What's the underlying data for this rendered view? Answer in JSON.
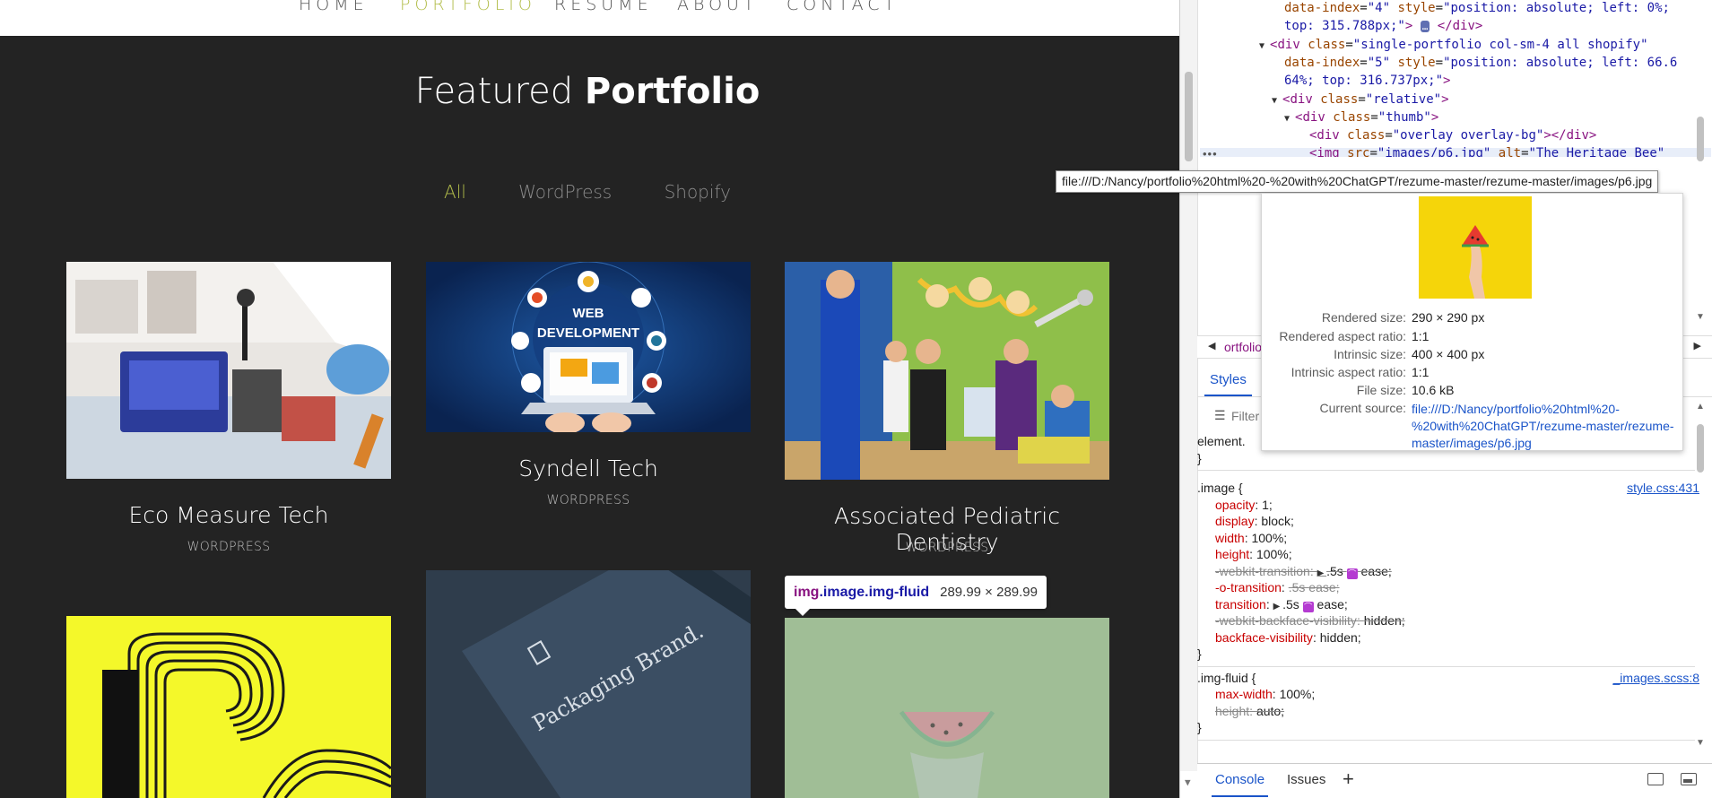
{
  "nav": {
    "items": [
      "HOME",
      "PORTFOLIO",
      "RESUME",
      "ABOUT",
      "CONTACT"
    ],
    "active": "PORTFOLIO"
  },
  "section": {
    "title_light": "Featured",
    "title_bold": "Portfolio"
  },
  "filters": [
    "All",
    "WordPress",
    "Shopify"
  ],
  "projects": [
    {
      "title": "Eco Measure Tech",
      "category": "WORDPRESS"
    },
    {
      "title": "Syndell Tech",
      "category": "WORDPRESS",
      "image_text": [
        "WEB",
        "DEVELOPMENT"
      ]
    },
    {
      "title": "Associated Pediatric Dentistry",
      "category": "WORDPRESS"
    },
    {
      "title": "",
      "category": ""
    },
    {
      "title": "",
      "category": "",
      "image_text": [
        "Packaging Brand."
      ]
    },
    {
      "title": "",
      "category": ""
    }
  ],
  "element_tooltip": {
    "selector_tag": "img",
    "selector_classes": ".image.img-fluid",
    "size": "289.99 × 289.99"
  },
  "devtools": {
    "dom_lines": [
      {
        "indent": 3,
        "parts": [
          [
            "attr",
            "data-index"
          ],
          [
            "txt",
            "="
          ],
          [
            "val",
            "\"4\""
          ],
          [
            "txt",
            " "
          ],
          [
            "attr",
            "style"
          ],
          [
            "txt",
            "="
          ],
          [
            "val",
            "\"position: absolute; left: 0%;"
          ]
        ]
      },
      {
        "indent": 3,
        "parts": [
          [
            "val",
            "top: 315.788px;\""
          ],
          [
            "tag",
            "> "
          ],
          [
            "ellips",
            "…"
          ],
          [
            "tag",
            " </div>"
          ]
        ]
      },
      {
        "indent": 2,
        "tri": "▼",
        "parts": [
          [
            "tag",
            "<div "
          ],
          [
            "attr",
            "class"
          ],
          [
            "txt",
            "="
          ],
          [
            "val",
            "\"single-portfolio col-sm-4 all shopify\""
          ]
        ]
      },
      {
        "indent": 3,
        "parts": [
          [
            "attr",
            "data-index"
          ],
          [
            "txt",
            "="
          ],
          [
            "val",
            "\"5\""
          ],
          [
            "txt",
            " "
          ],
          [
            "attr",
            "style"
          ],
          [
            "txt",
            "="
          ],
          [
            "val",
            "\"position: absolute; left: 66.6"
          ]
        ]
      },
      {
        "indent": 3,
        "parts": [
          [
            "val",
            "64%; top: 316.737px;\""
          ],
          [
            "tag",
            ">"
          ]
        ]
      },
      {
        "indent": 3,
        "tri": "▼",
        "parts": [
          [
            "tag",
            "<div "
          ],
          [
            "attr",
            "class"
          ],
          [
            "txt",
            "="
          ],
          [
            "val",
            "\"relative\""
          ],
          [
            "tag",
            ">"
          ]
        ]
      },
      {
        "indent": 4,
        "tri": "▼",
        "parts": [
          [
            "tag",
            "<div "
          ],
          [
            "attr",
            "class"
          ],
          [
            "txt",
            "="
          ],
          [
            "val",
            "\"thumb\""
          ],
          [
            "tag",
            ">"
          ]
        ]
      },
      {
        "indent": 5,
        "parts": [
          [
            "tag",
            "<div "
          ],
          [
            "attr",
            "class"
          ],
          [
            "txt",
            "="
          ],
          [
            "val",
            "\"overlay overlay-bg\""
          ],
          [
            "tag",
            "></div>"
          ]
        ]
      },
      {
        "indent": 5,
        "parts": [
          [
            "tag",
            "<img "
          ],
          [
            "attr",
            "src"
          ],
          [
            "txt",
            "="
          ],
          [
            "val",
            "\"images/p6.jpg\""
          ],
          [
            "txt",
            " "
          ],
          [
            "attr",
            "alt"
          ],
          [
            "txt",
            "="
          ],
          [
            "val",
            "\"The Heritage Bee\""
          ]
        ]
      }
    ],
    "dots": "•••",
    "url_tooltip": "file:///D:/Nancy/portfolio%20html%20-%20with%20ChatGPT/rezume-master/rezume-master/images/p6.jpg",
    "image_popup": {
      "rows": [
        {
          "k": "Rendered size:",
          "v": "290 × 290 px"
        },
        {
          "k": "Rendered aspect ratio:",
          "v": "1:1"
        },
        {
          "k": "Intrinsic size:",
          "v": "400 × 400 px"
        },
        {
          "k": "Intrinsic aspect ratio:",
          "v": "1:1"
        },
        {
          "k": "File size:",
          "v": "10.6 kB"
        }
      ],
      "source_label": "Current source:",
      "source_value": "file:///D:/Nancy/portfolio%20html%20-%20with%20ChatGPT/rezume-master/rezume-master/images/p6.jpg"
    },
    "breadcrumb_text": "ortfolio",
    "styles_tab": "Styles",
    "filter_placeholder": "Filter",
    "styles": {
      "element_line": "element.",
      "close": "}",
      "rule1": {
        "selector": ".image {",
        "source": "style.css:431",
        "decls": [
          {
            "p": "opacity",
            "v": "1;"
          },
          {
            "p": "display",
            "v": "block;"
          },
          {
            "p": "width",
            "v": "100%;"
          },
          {
            "p": "height",
            "v": "100%;"
          },
          {
            "p": "-webkit-transition",
            "v": ".5s ease;",
            "strike": true,
            "tri": true,
            "sw": true
          },
          {
            "p": "-o-transition",
            "v": ".5s ease;",
            "strike_val": true
          },
          {
            "p": "transition",
            "v": ".5s ease;",
            "tri": true,
            "sw": true
          },
          {
            "p": "-webkit-backface-visibility",
            "v": "hidden;",
            "strike": true
          },
          {
            "p": "backface-visibility",
            "v": "hidden;"
          }
        ]
      },
      "rule2": {
        "selector": ".img-fluid {",
        "source": "_images.scss:8",
        "decls": [
          {
            "p": "max-width",
            "v": "100%;"
          },
          {
            "p": "height",
            "v": "auto;",
            "strike": true
          }
        ]
      }
    },
    "bottom_tabs": [
      "Console",
      "Issues"
    ]
  },
  "colors": {
    "accent": "#b2bd4a",
    "page_bg": "#232323",
    "link": "#1a54c9"
  }
}
